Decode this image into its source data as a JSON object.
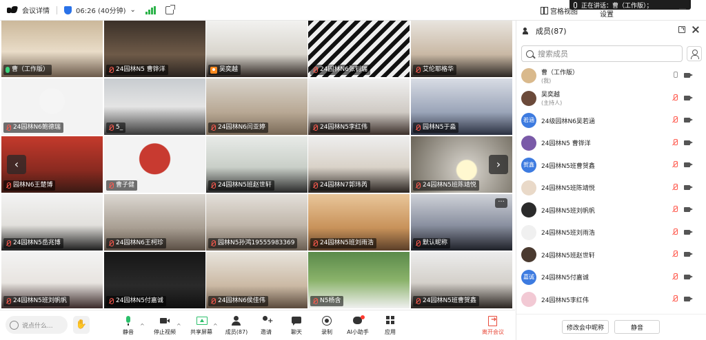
{
  "topbar": {
    "meeting_details": "会议详情",
    "duration": "06:26 (40分钟)",
    "duration_caret": "⌄",
    "view_label": "宫格视图",
    "settings_label": "设置",
    "speaking_text": "正在讲话：曹（工作版）；"
  },
  "grid": {
    "tiles": [
      {
        "name": "曹（工作版）",
        "state": "speaking"
      },
      {
        "name": "24园林N5 曹铧洋",
        "state": "muted"
      },
      {
        "name": "吴奕越",
        "state": "host"
      },
      {
        "name": "24园林N6张钊瑞",
        "state": "muted"
      },
      {
        "name": "艾伦耶格华",
        "state": "muted"
      },
      {
        "name": "24园林N6鲍德瑞",
        "state": "muted"
      },
      {
        "name": "5_",
        "state": "muted"
      },
      {
        "name": "24园林N6闫亚婷",
        "state": "muted"
      },
      {
        "name": "24园林N5李红伟",
        "state": "muted"
      },
      {
        "name": "园林N5于淼",
        "state": "muted"
      },
      {
        "name": "园林N6王楚博",
        "state": "muted"
      },
      {
        "name": "曹子健",
        "state": "muted"
      },
      {
        "name": "24园林N5班赵世轩",
        "state": "muted"
      },
      {
        "name": "24园林N7郭玮芮",
        "state": "muted"
      },
      {
        "name": "24园林N5班陈靖悦",
        "state": "muted"
      },
      {
        "name": "24园林N5岳兆博",
        "state": "muted"
      },
      {
        "name": "24园林N6王柯珍",
        "state": "muted"
      },
      {
        "name": "园林N5孙鸿19555983369",
        "state": "muted"
      },
      {
        "name": "24园林N5班刘雨浩",
        "state": "muted"
      },
      {
        "name": "默认昵称",
        "state": "muted"
      },
      {
        "name": "24园林N5班刘帆帆",
        "state": "muted"
      },
      {
        "name": "24园林N5付嘉诚",
        "state": "muted"
      },
      {
        "name": "24园林N6侯佳伟",
        "state": "muted"
      },
      {
        "name": "N5杨含",
        "state": "muted"
      },
      {
        "name": "24园林N5班曹贺鑫",
        "state": "muted"
      }
    ],
    "prev_arrow": "‹",
    "next_arrow": "›",
    "more": "···"
  },
  "panel": {
    "title": "成员(87)",
    "search_placeholder": "搜索成员",
    "members": [
      {
        "name": "曹（工作版）",
        "sub": "(我)",
        "avatar": "",
        "color": "#d9b98c",
        "muted": false
      },
      {
        "name": "吴奕越",
        "sub": "(主持人)",
        "avatar": "",
        "color": "#6b4a3a",
        "muted": true
      },
      {
        "name": "24级园林N6吴若涵",
        "sub": "",
        "avatar": "若涵",
        "color": "#3d7be0",
        "muted": true
      },
      {
        "name": "24园林N5 曹铧洋",
        "sub": "",
        "avatar": "",
        "color": "#7a5aa8",
        "muted": true
      },
      {
        "name": "24园林N5班曹贺鑫",
        "sub": "",
        "avatar": "贺鑫",
        "color": "#3d7be0",
        "muted": true
      },
      {
        "name": "24园林N5班陈靖悦",
        "sub": "",
        "avatar": "",
        "color": "#e9d9c8",
        "muted": true
      },
      {
        "name": "24园林N5班刘帆帆",
        "sub": "",
        "avatar": "",
        "color": "#2b2b2b",
        "muted": true
      },
      {
        "name": "24园林N5班刘雨浩",
        "sub": "",
        "avatar": "",
        "color": "#f0f0f0",
        "muted": true
      },
      {
        "name": "24园林N5班赵世轩",
        "sub": "",
        "avatar": "",
        "color": "#4a3a30",
        "muted": true
      },
      {
        "name": "24园林N5付嘉诚",
        "sub": "",
        "avatar": "嘉诚",
        "color": "#3d7be0",
        "muted": true
      },
      {
        "name": "24园林N5李红伟",
        "sub": "",
        "avatar": "",
        "color": "#f2c9d4",
        "muted": true
      }
    ],
    "rename_button": "修改会中昵称",
    "mute_button": "静音"
  },
  "toolbar": {
    "chat_placeholder": "说点什么...",
    "tools": [
      {
        "label": "静音",
        "icon": "mic"
      },
      {
        "label": "停止视频",
        "icon": "cam"
      },
      {
        "label": "共享屏幕",
        "icon": "share"
      },
      {
        "label": "成员(87)",
        "icon": "members"
      },
      {
        "label": "邀请",
        "icon": "invite"
      },
      {
        "label": "聊天",
        "icon": "chat"
      },
      {
        "label": "录制",
        "icon": "rec"
      },
      {
        "label": "AI小助手",
        "icon": "ai"
      },
      {
        "label": "应用",
        "icon": "apps"
      }
    ],
    "leave_label": "离开会议"
  }
}
